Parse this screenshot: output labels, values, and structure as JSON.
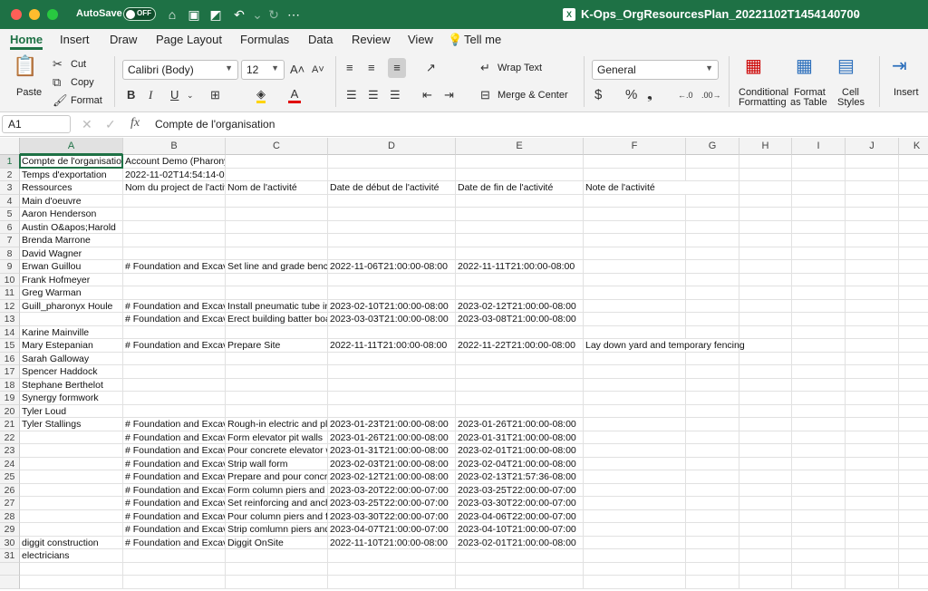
{
  "window": {
    "autosave_label": "AutoSave",
    "autosave_state": "OFF",
    "title": "K-Ops_OrgResourcesPlan_20221102T1454140700",
    "accent_color": "#1e7145"
  },
  "ribbon_tabs": [
    "Home",
    "Insert",
    "Draw",
    "Page Layout",
    "Formulas",
    "Data",
    "Review",
    "View",
    "Tell me"
  ],
  "ribbon": {
    "paste": "Paste",
    "cut": "Cut",
    "copy": "Copy",
    "format": "Format",
    "font_name": "Calibri (Body)",
    "font_size": "12",
    "wrap_text": "Wrap Text",
    "merge_center": "Merge & Center",
    "number_format": "General",
    "conditional_formatting_1": "Conditional",
    "conditional_formatting_2": "Formatting",
    "format_as_table_1": "Format",
    "format_as_table_2": "as Table",
    "cell_styles_1": "Cell",
    "cell_styles_2": "Styles",
    "insert": "Insert"
  },
  "formula_bar": {
    "name_box": "A1",
    "fx": "fx",
    "content": "Compte de l'organisation"
  },
  "columns": [
    "A",
    "B",
    "C",
    "D",
    "E",
    "F",
    "G",
    "H",
    "I",
    "J",
    "K"
  ],
  "rows": [
    {
      "n": "1",
      "A": "Compte de l'organisation",
      "B": "Account Demo (Pharonyx)",
      "C": "",
      "D": "",
      "E": "",
      "F": ""
    },
    {
      "n": "2",
      "A": "Temps d'exportation",
      "B": "2022-11-02T14:54:14-07:00",
      "C": "",
      "D": "",
      "E": "",
      "F": ""
    },
    {
      "n": "3",
      "A": "Ressources",
      "B": "Nom du project de l'activi",
      "C": "Nom de l'activité",
      "D": "Date de début de l'activité",
      "E": "Date de fin de l'activité",
      "F": "Note de l'activité"
    },
    {
      "n": "4",
      "A": "Main d'oeuvre",
      "B": "",
      "C": "",
      "D": "",
      "E": "",
      "F": ""
    },
    {
      "n": "5",
      "A": "Aaron Henderson",
      "B": "",
      "C": "",
      "D": "",
      "E": "",
      "F": ""
    },
    {
      "n": "6",
      "A": "Austin O&apos;Harold",
      "B": "",
      "C": "",
      "D": "",
      "E": "",
      "F": ""
    },
    {
      "n": "7",
      "A": "Brenda Marrone",
      "B": "",
      "C": "",
      "D": "",
      "E": "",
      "F": ""
    },
    {
      "n": "8",
      "A": "David Wagner",
      "B": "",
      "C": "",
      "D": "",
      "E": "",
      "F": ""
    },
    {
      "n": "9",
      "A": "Erwan Guillou",
      "B": "# Foundation and Excavat",
      "C": "Set line and grade bench",
      "D": "2022-11-06T21:00:00-08:00",
      "E": "2022-11-11T21:00:00-08:00",
      "F": ""
    },
    {
      "n": "10",
      "A": "Frank Hofmeyer",
      "B": "",
      "C": "",
      "D": "",
      "E": "",
      "F": ""
    },
    {
      "n": "11",
      "A": "Greg Warman",
      "B": "",
      "C": "",
      "D": "",
      "E": "",
      "F": ""
    },
    {
      "n": "12",
      "A": "Guill_pharonyx Houle",
      "B": "# Foundation and Excavat",
      "C": "Install pneumatic tube in",
      "D": "2023-02-10T21:00:00-08:00",
      "E": "2023-02-12T21:00:00-08:00",
      "F": ""
    },
    {
      "n": "13",
      "A": "",
      "B": "# Foundation and Excavat",
      "C": "Erect building batter boa",
      "D": "2023-03-03T21:00:00-08:00",
      "E": "2023-03-08T21:00:00-08:00",
      "F": ""
    },
    {
      "n": "14",
      "A": "Karine Mainville",
      "B": "",
      "C": "",
      "D": "",
      "E": "",
      "F": ""
    },
    {
      "n": "15",
      "A": "Mary Estepanian",
      "B": "# Foundation and Excavat",
      "C": "Prepare Site",
      "D": "2022-11-11T21:00:00-08:00",
      "E": "2022-11-22T21:00:00-08:00",
      "F": "Lay down yard and temporary fencing"
    },
    {
      "n": "16",
      "A": "Sarah Galloway",
      "B": "",
      "C": "",
      "D": "",
      "E": "",
      "F": ""
    },
    {
      "n": "17",
      "A": "Spencer Haddock",
      "B": "",
      "C": "",
      "D": "",
      "E": "",
      "F": ""
    },
    {
      "n": "18",
      "A": "Stephane Berthelot",
      "B": "",
      "C": "",
      "D": "",
      "E": "",
      "F": ""
    },
    {
      "n": "19",
      "A": "Synergy formwork",
      "B": "",
      "C": "",
      "D": "",
      "E": "",
      "F": ""
    },
    {
      "n": "20",
      "A": "Tyler Loud",
      "B": "",
      "C": "",
      "D": "",
      "E": "",
      "F": ""
    },
    {
      "n": "21",
      "A": "Tyler Stallings",
      "B": "# Foundation and Excavat",
      "C": "Rough-in electric and plu",
      "D": "2023-01-23T21:00:00-08:00",
      "E": "2023-01-26T21:00:00-08:00",
      "F": ""
    },
    {
      "n": "22",
      "A": "",
      "B": "# Foundation and Excavat",
      "C": "Form elevator pit walls",
      "D": "2023-01-26T21:00:00-08:00",
      "E": "2023-01-31T21:00:00-08:00",
      "F": ""
    },
    {
      "n": "23",
      "A": "",
      "B": "# Foundation and Excavat",
      "C": "Pour concrete elevator w",
      "D": "2023-01-31T21:00:00-08:00",
      "E": "2023-02-01T21:00:00-08:00",
      "F": ""
    },
    {
      "n": "24",
      "A": "",
      "B": "# Foundation and Excavat",
      "C": "Strip wall form",
      "D": "2023-02-03T21:00:00-08:00",
      "E": "2023-02-04T21:00:00-08:00",
      "F": ""
    },
    {
      "n": "25",
      "A": "",
      "B": "# Foundation and Excavat",
      "C": "Prepare and pour concret",
      "D": "2023-02-12T21:00:00-08:00",
      "E": "2023-02-13T21:57:36-08:00",
      "F": ""
    },
    {
      "n": "26",
      "A": "",
      "B": "# Foundation and Excavat",
      "C": "Form column piers and s",
      "D": "2023-03-20T22:00:00-07:00",
      "E": "2023-03-25T22:00:00-07:00",
      "F": ""
    },
    {
      "n": "27",
      "A": "",
      "B": "# Foundation and Excavat",
      "C": "Set reinforcing and ancho",
      "D": "2023-03-25T22:00:00-07:00",
      "E": "2023-03-30T22:00:00-07:00",
      "F": ""
    },
    {
      "n": "28",
      "A": "",
      "B": "# Foundation and Excavat",
      "C": "Pour column piers and fo",
      "D": "2023-03-30T22:00:00-07:00",
      "E": "2023-04-06T22:00:00-07:00",
      "F": ""
    },
    {
      "n": "29",
      "A": "",
      "B": "# Foundation and Excavat",
      "C": "Strip comlumn piers and",
      "D": "2023-04-07T21:00:00-07:00",
      "E": "2023-04-10T21:00:00-07:00",
      "F": ""
    },
    {
      "n": "30",
      "A": "diggit construction",
      "B": "# Foundation and Excavat",
      "C": "Diggit OnSite",
      "D": "2022-11-10T21:00:00-08:00",
      "E": "2023-02-01T21:00:00-08:00",
      "F": ""
    },
    {
      "n": "31",
      "A": "electricians",
      "B": "",
      "C": "",
      "D": "",
      "E": "",
      "F": ""
    }
  ]
}
